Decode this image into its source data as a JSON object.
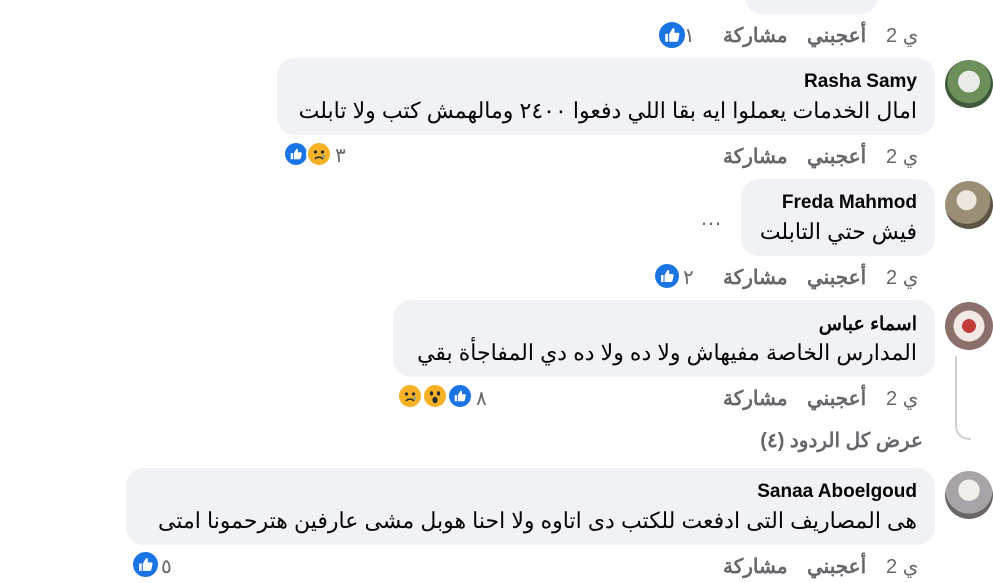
{
  "labels": {
    "like": "أعجبني",
    "share": "مشاركة"
  },
  "top": {
    "time": "2 ي",
    "reactions": "١"
  },
  "comments": [
    {
      "name": "Rasha Samy",
      "text": "امال الخدمات يعملوا ايه بقا اللي دفعوا ٢٤٠٠ ومالهمش كتب ولا تابلت",
      "time": "2 ي",
      "reactions": "٣"
    },
    {
      "name": "Freda Mahmod",
      "text": "فيش حتي التابلت",
      "time": "2 ي",
      "reactions": "٢",
      "more": "…"
    },
    {
      "name": "اسماء عباس",
      "text": "المدارس الخاصة مفيهاش ولا ده ولا ده دي المفاجأة بقي",
      "time": "2 ي",
      "reactions": "٨"
    },
    {
      "name": "Sanaa Aboelgoud",
      "text": "هى المصاريف التى ادفعت للكتب دى اتاوه ولا احنا هوبل مشى عارفين هترحمونا امتى",
      "time": "2 ي",
      "reactions": "٥"
    }
  ],
  "replies": {
    "view_all": "عرض كل الردود (٤)"
  },
  "colors": {
    "bubble": "#f0f2f5",
    "like_blue": "#1b74e4",
    "meta_gray": "#65676b"
  }
}
